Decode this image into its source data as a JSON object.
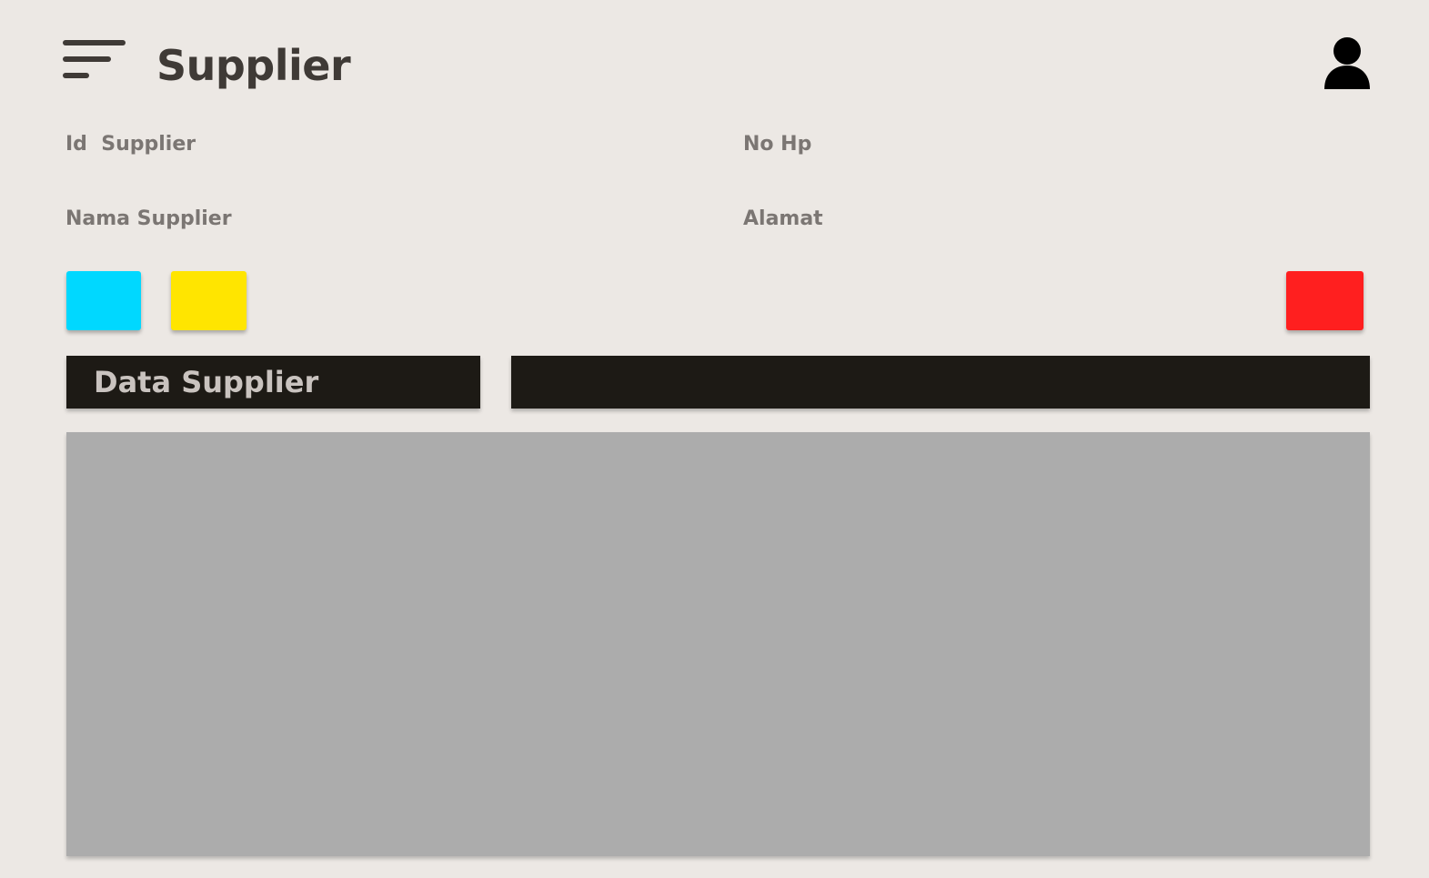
{
  "header": {
    "title": "Supplier",
    "menu_icon": "hamburger-menu-icon",
    "user_icon": "user-icon"
  },
  "form": {
    "id_supplier_label": "Id  Supplier",
    "no_hp_label": "No Hp",
    "nama_supplier_label": "Nama Supplier",
    "alamat_label": "Alamat"
  },
  "actions": {
    "btn1_color": "#00d8ff",
    "btn2_color": "#ffe500",
    "btn3_color": "#ff1f1f"
  },
  "data_section": {
    "title": "Data Supplier",
    "bar_color": "#1d1a15",
    "table_color": "#acacac"
  }
}
